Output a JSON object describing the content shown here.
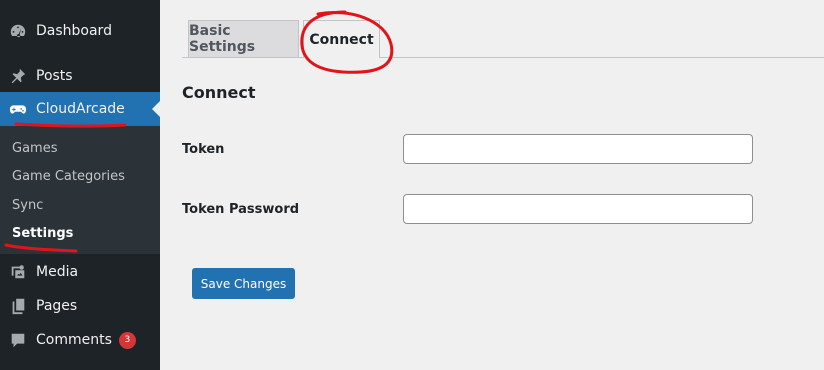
{
  "sidebar": {
    "items": [
      {
        "label": "Dashboard",
        "icon": "dashboard-icon"
      },
      {
        "label": "Posts",
        "icon": "pin-icon"
      },
      {
        "label": "CloudArcade",
        "icon": "gamepad-icon"
      },
      {
        "label": "Media",
        "icon": "media-icon"
      },
      {
        "label": "Pages",
        "icon": "page-icon"
      },
      {
        "label": "Comments",
        "icon": "comment-icon",
        "badge": "3"
      }
    ],
    "submenu": [
      "Games",
      "Game Categories",
      "Sync",
      "Settings"
    ]
  },
  "tabs": [
    {
      "label": "Basic Settings"
    },
    {
      "label": "Connect"
    }
  ],
  "main": {
    "section_title": "Connect",
    "fields": [
      {
        "label": "Token",
        "value": ""
      },
      {
        "label": "Token Password",
        "value": ""
      }
    ],
    "save_label": "Save Changes"
  },
  "colors": {
    "sidebar_bg": "#1d2327",
    "submenu_bg": "#2c3338",
    "accent": "#2271b1",
    "annotation": "#e0141a",
    "badge": "#d63638"
  }
}
